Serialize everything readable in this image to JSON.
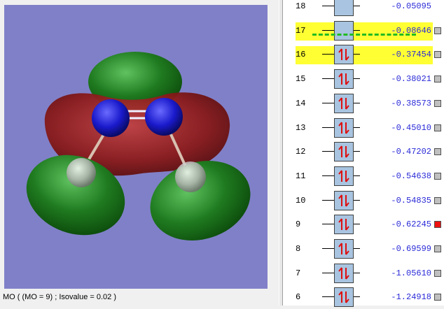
{
  "viewer": {
    "status": "MO ( (MO = 9) ; Isovalue = 0.02 )",
    "background_color": "#8080c8"
  },
  "orbitals": [
    {
      "index": "18",
      "energy": "-0.05095",
      "occupied": false,
      "highlight": false,
      "selected": false
    },
    {
      "index": "17",
      "energy": "-0.08646",
      "occupied": false,
      "highlight": true,
      "selected": false
    },
    {
      "index": "16",
      "energy": "-0.37454",
      "occupied": true,
      "highlight": true,
      "selected": false
    },
    {
      "index": "15",
      "energy": "-0.38021",
      "occupied": true,
      "highlight": false,
      "selected": false
    },
    {
      "index": "14",
      "energy": "-0.38573",
      "occupied": true,
      "highlight": false,
      "selected": false
    },
    {
      "index": "13",
      "energy": "-0.45010",
      "occupied": true,
      "highlight": false,
      "selected": false
    },
    {
      "index": "12",
      "energy": "-0.47202",
      "occupied": true,
      "highlight": false,
      "selected": false
    },
    {
      "index": "11",
      "energy": "-0.54638",
      "occupied": true,
      "highlight": false,
      "selected": false
    },
    {
      "index": "10",
      "energy": "-0.54835",
      "occupied": true,
      "highlight": false,
      "selected": false
    },
    {
      "index": "9",
      "energy": "-0.62245",
      "occupied": true,
      "highlight": false,
      "selected": true
    },
    {
      "index": "8",
      "energy": "-0.69599",
      "occupied": true,
      "highlight": false,
      "selected": false
    },
    {
      "index": "7",
      "energy": "-1.05610",
      "occupied": true,
      "highlight": false,
      "selected": false
    },
    {
      "index": "6",
      "energy": "-1.24918",
      "occupied": true,
      "highlight": false,
      "selected": false
    }
  ],
  "colors": {
    "highlight": "#ffff33",
    "energy_text": "#2a2ad8",
    "homo_lumo_divider": "#22bb22",
    "selected_checkbox": "#ee1111",
    "orbital_positive": "#1f7a1f",
    "orbital_negative": "#8a1a1a"
  }
}
